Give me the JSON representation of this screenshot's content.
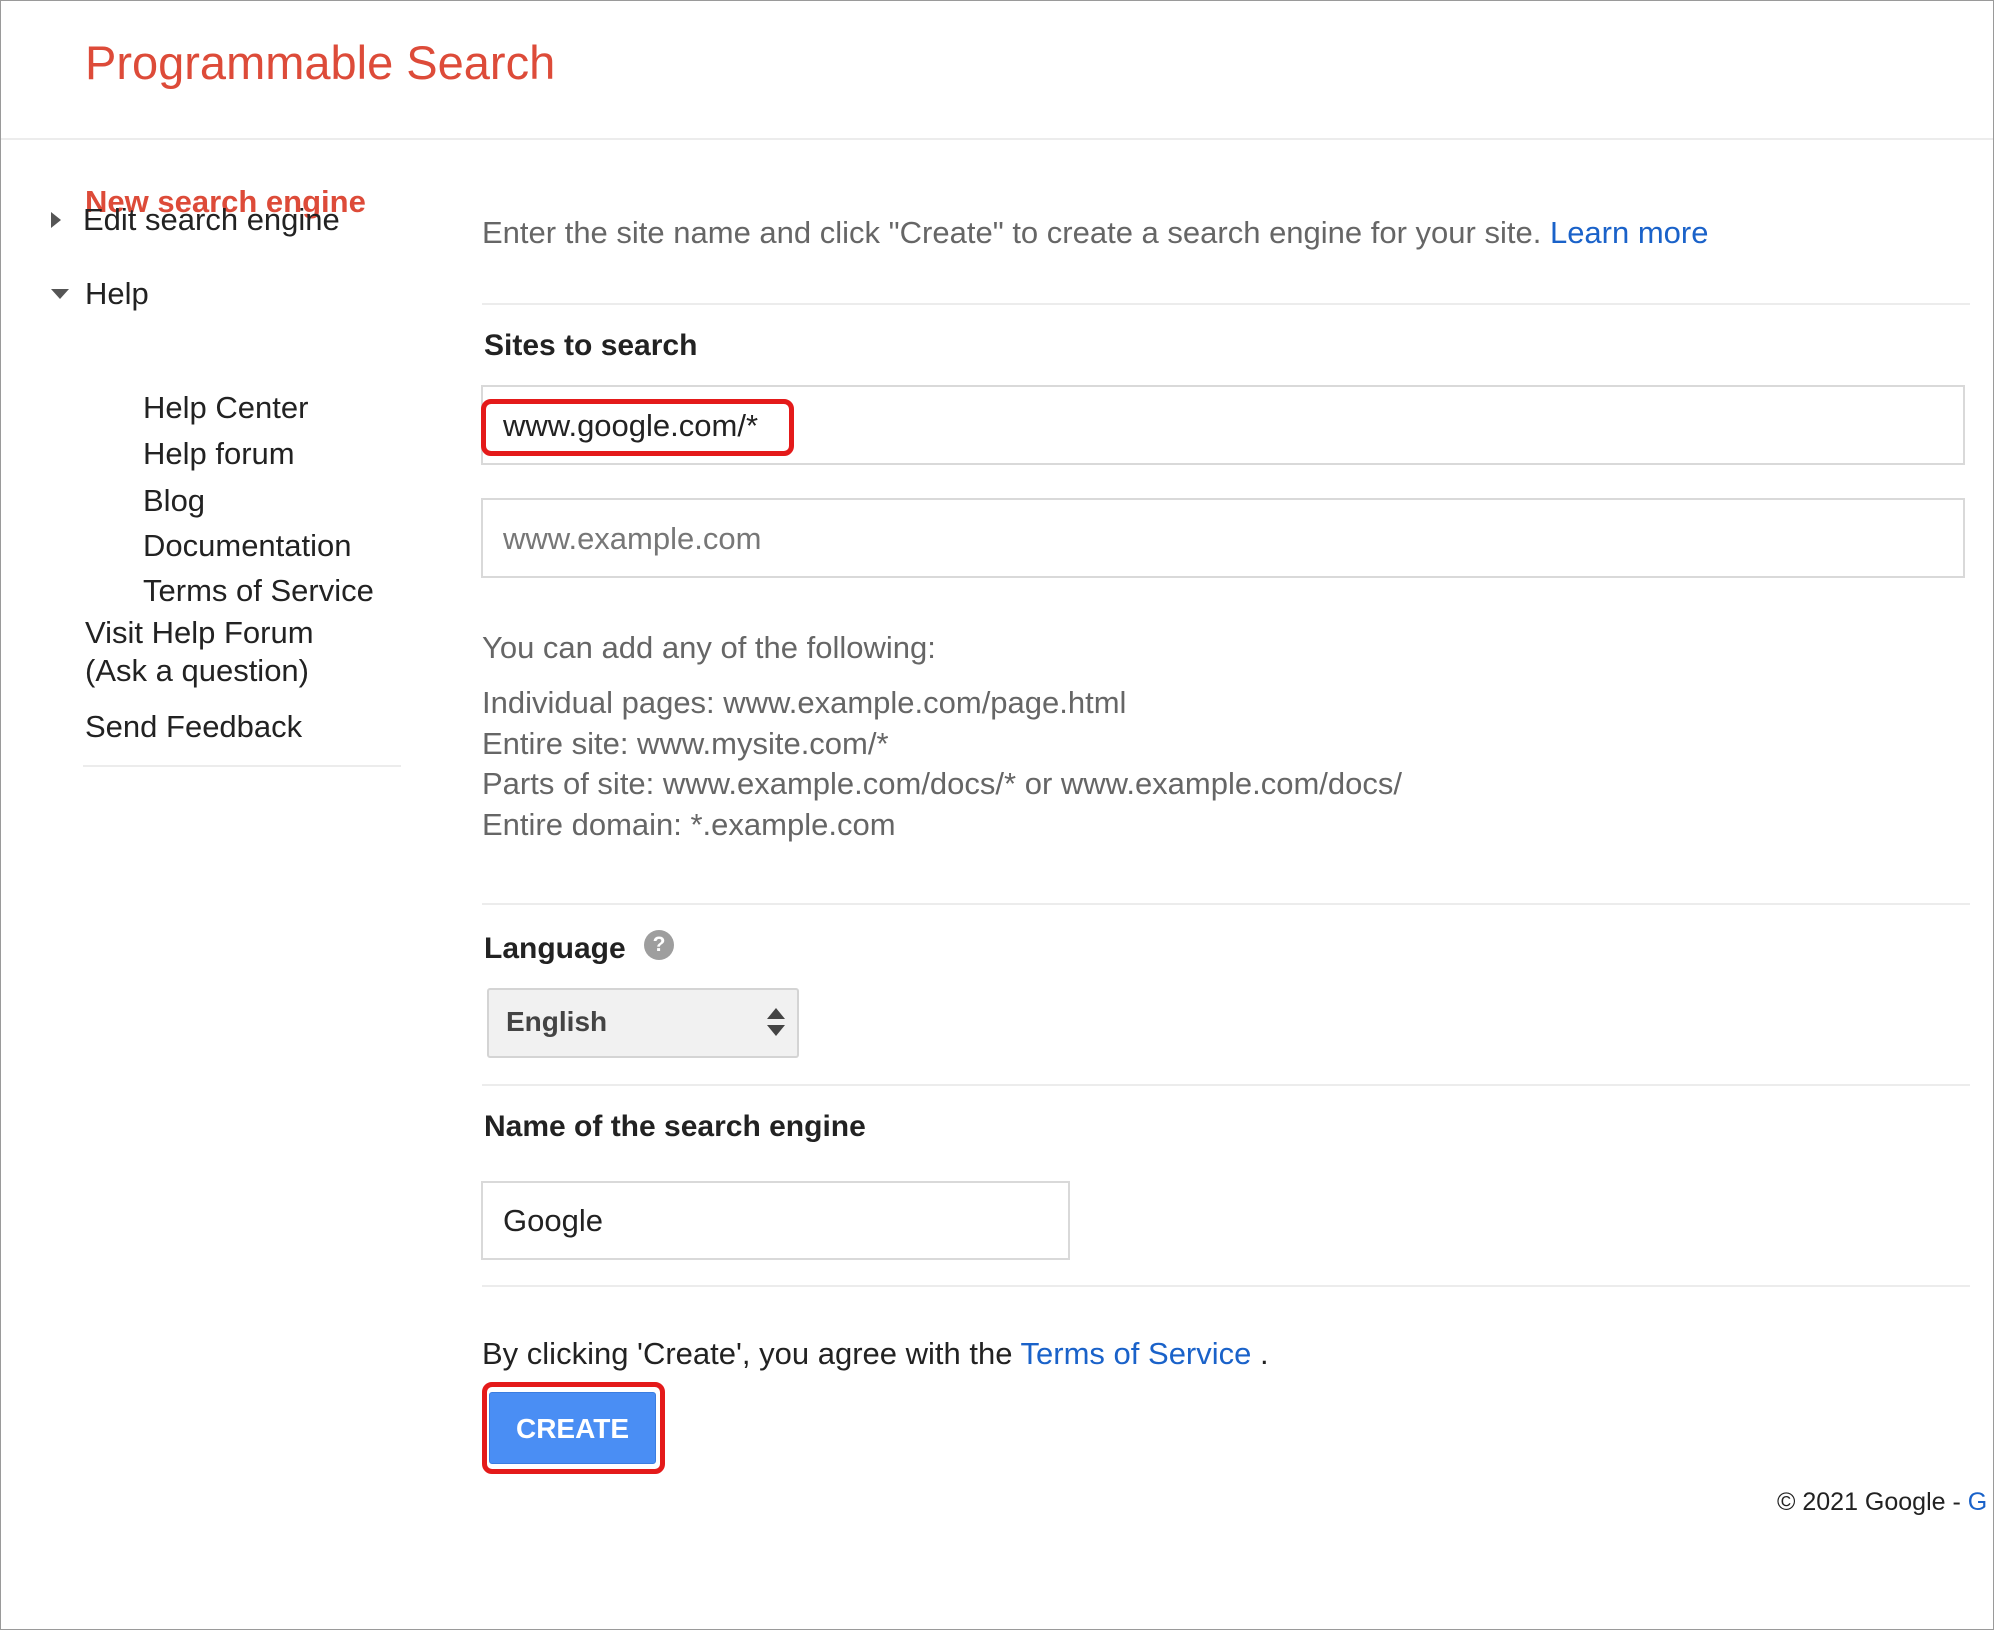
{
  "app": {
    "title": "Programmable Search"
  },
  "sidebar": {
    "new_search_engine": "New search engine",
    "edit_search_engine": "Edit search engine",
    "help": "Help",
    "help_items": [
      "Help Center",
      "Help forum",
      "Blog",
      "Documentation",
      "Terms of Service"
    ],
    "visit_help_forum_line1": "Visit Help Forum",
    "visit_help_forum_line2": "(Ask a question)",
    "send_feedback": "Send Feedback"
  },
  "main": {
    "intro_text": "Enter the site name and click \"Create\" to create a search engine for your site.",
    "learn_more": "Learn more",
    "sites_label": "Sites to search",
    "site_value": "www.google.com/*",
    "site_placeholder": "www.example.com",
    "hint_header": "You can add any of the following:",
    "hints": [
      "Individual pages: www.example.com/page.html",
      "Entire site: www.mysite.com/*",
      "Parts of site: www.example.com/docs/* or www.example.com/docs/",
      "Entire domain: *.example.com"
    ],
    "language_label": "Language",
    "language_help_icon": "?",
    "language_value": "English",
    "name_label": "Name of the search engine",
    "name_value": "Google",
    "agree_prefix": "By clicking 'Create', you agree with the",
    "terms_link": "Terms of Service",
    "agree_suffix": ".",
    "create_button": "CREATE"
  },
  "footer": {
    "copyright": "© 2021 Google",
    "separator": "-",
    "link_fragment": "G"
  },
  "colors": {
    "brand_red": "#dd4b39",
    "link_blue": "#1a62c9",
    "button_blue": "#4a8ef4",
    "highlight_red": "#e41a1a"
  }
}
